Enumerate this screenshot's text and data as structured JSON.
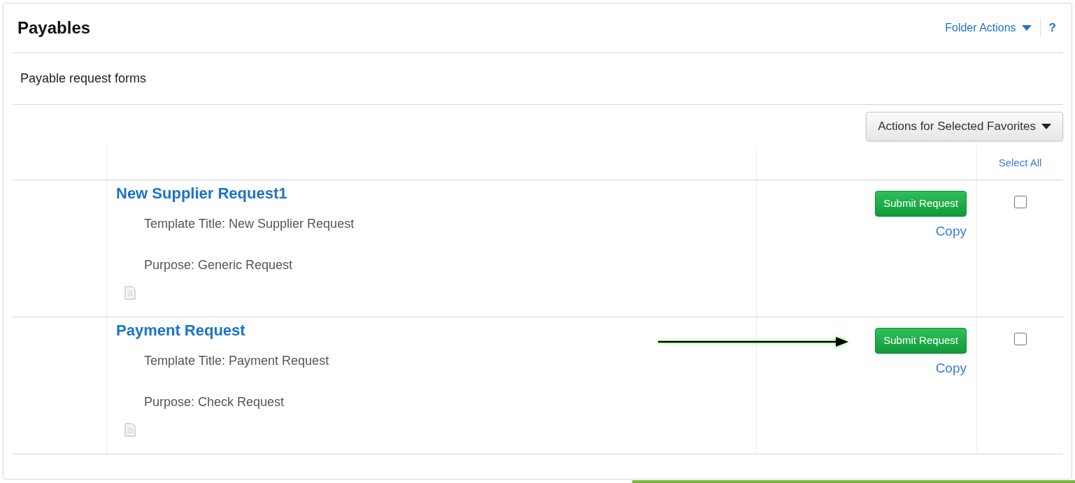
{
  "header": {
    "title": "Payables",
    "folder_actions": "Folder Actions",
    "help": "?"
  },
  "description": "Payable request forms",
  "actions_button": "Actions for Selected Favorites",
  "select_all": "Select All",
  "rows": [
    {
      "name": "New Supplier Request1",
      "template_title": "Template Title: New Supplier Request",
      "purpose": "Purpose: Generic Request",
      "submit": "Submit Request",
      "copy": "Copy",
      "checked": false,
      "highlighted": false
    },
    {
      "name": "Payment Request",
      "template_title": "Template Title: Payment Request",
      "purpose": "Purpose: Check Request",
      "submit": "Submit Request",
      "copy": "Copy",
      "checked": false,
      "highlighted": true
    }
  ]
}
